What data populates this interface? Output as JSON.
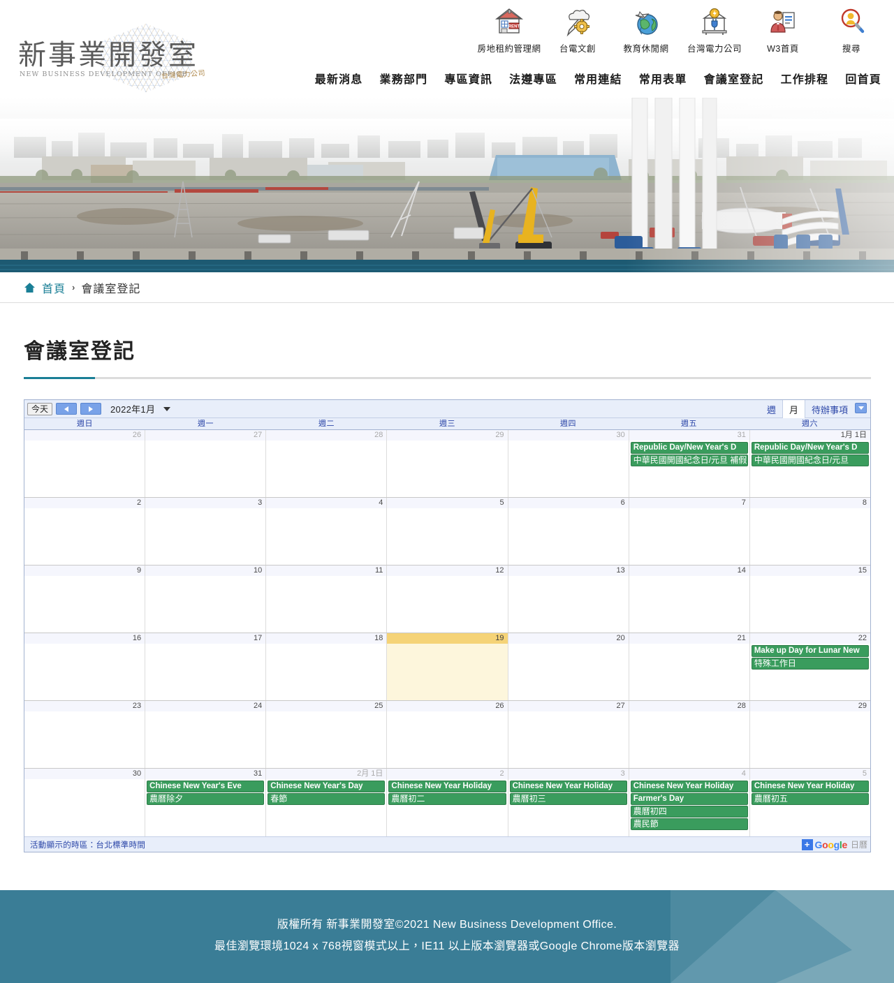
{
  "site": {
    "logo_cn": "新事業開發室",
    "logo_en": "NEW BUSINESS DEVELOPMENT OFFICE",
    "logo_stamp": "台灣電力公司"
  },
  "quicklinks": [
    {
      "label": "房地租約管理網",
      "icon": "house-rent-icon"
    },
    {
      "label": "台電文創",
      "icon": "pen-gear-icon"
    },
    {
      "label": "教育休閒網",
      "icon": "globe-plane-icon"
    },
    {
      "label": "台灣電力公司",
      "icon": "power-plant-icon"
    },
    {
      "label": "W3首頁",
      "icon": "person-document-icon"
    },
    {
      "label": "搜尋",
      "icon": "search-person-icon"
    }
  ],
  "mainnav": [
    {
      "label": "最新消息"
    },
    {
      "label": "業務部門"
    },
    {
      "label": "專區資訊"
    },
    {
      "label": "法遵專區"
    },
    {
      "label": "常用連結"
    },
    {
      "label": "常用表單"
    },
    {
      "label": "會議室登記"
    },
    {
      "label": "工作排程"
    },
    {
      "label": "回首頁"
    }
  ],
  "breadcrumb": {
    "home_label": "首頁",
    "separator": "›",
    "current": "會議室登記"
  },
  "page": {
    "title": "會議室登記",
    "accent_color": "#1a7f96"
  },
  "calendar": {
    "today_button": "今天",
    "prev_label": "◀",
    "next_label": "▶",
    "range_label": "2022年1月",
    "views": [
      {
        "label": "週",
        "active": false
      },
      {
        "label": "月",
        "active": true
      },
      {
        "label": "待辦事項",
        "active": false
      }
    ],
    "dow": [
      "週日",
      "週一",
      "週二",
      "週三",
      "週四",
      "週五",
      "週六"
    ],
    "timezone_note": "活動顯示的時區：台北標準時間",
    "google_badge": {
      "plus": "+",
      "word": "Google",
      "suffix": "日曆"
    },
    "event_color": "#3a9c5d",
    "today_color": "#f5d377",
    "weeks": [
      [
        {
          "num": "26",
          "other": true,
          "today": false,
          "events": []
        },
        {
          "num": "27",
          "other": true,
          "today": false,
          "events": []
        },
        {
          "num": "28",
          "other": true,
          "today": false,
          "events": []
        },
        {
          "num": "29",
          "other": true,
          "today": false,
          "events": []
        },
        {
          "num": "30",
          "other": true,
          "today": false,
          "events": []
        },
        {
          "num": "31",
          "other": true,
          "today": false,
          "events": [
            {
              "title": "Republic Day/New Year's D",
              "cn": false
            },
            {
              "title": "中華民國開國紀念日/元旦 補假",
              "cn": true
            }
          ]
        },
        {
          "num": "1月 1日",
          "other": false,
          "today": false,
          "events": [
            {
              "title": "Republic Day/New Year's D",
              "cn": false
            },
            {
              "title": "中華民國開國紀念日/元旦",
              "cn": true
            }
          ]
        }
      ],
      [
        {
          "num": "2",
          "other": false,
          "today": false,
          "events": []
        },
        {
          "num": "3",
          "other": false,
          "today": false,
          "events": []
        },
        {
          "num": "4",
          "other": false,
          "today": false,
          "events": []
        },
        {
          "num": "5",
          "other": false,
          "today": false,
          "events": []
        },
        {
          "num": "6",
          "other": false,
          "today": false,
          "events": []
        },
        {
          "num": "7",
          "other": false,
          "today": false,
          "events": []
        },
        {
          "num": "8",
          "other": false,
          "today": false,
          "events": []
        }
      ],
      [
        {
          "num": "9",
          "other": false,
          "today": false,
          "events": []
        },
        {
          "num": "10",
          "other": false,
          "today": false,
          "events": []
        },
        {
          "num": "11",
          "other": false,
          "today": false,
          "events": []
        },
        {
          "num": "12",
          "other": false,
          "today": false,
          "events": []
        },
        {
          "num": "13",
          "other": false,
          "today": false,
          "events": []
        },
        {
          "num": "14",
          "other": false,
          "today": false,
          "events": []
        },
        {
          "num": "15",
          "other": false,
          "today": false,
          "events": []
        }
      ],
      [
        {
          "num": "16",
          "other": false,
          "today": false,
          "events": []
        },
        {
          "num": "17",
          "other": false,
          "today": false,
          "events": []
        },
        {
          "num": "18",
          "other": false,
          "today": false,
          "events": []
        },
        {
          "num": "19",
          "other": false,
          "today": true,
          "events": []
        },
        {
          "num": "20",
          "other": false,
          "today": false,
          "events": []
        },
        {
          "num": "21",
          "other": false,
          "today": false,
          "events": []
        },
        {
          "num": "22",
          "other": false,
          "today": false,
          "events": [
            {
              "title": "Make up Day for Lunar New",
              "cn": false
            },
            {
              "title": "特殊工作日",
              "cn": true
            }
          ]
        }
      ],
      [
        {
          "num": "23",
          "other": false,
          "today": false,
          "events": []
        },
        {
          "num": "24",
          "other": false,
          "today": false,
          "events": []
        },
        {
          "num": "25",
          "other": false,
          "today": false,
          "events": []
        },
        {
          "num": "26",
          "other": false,
          "today": false,
          "events": []
        },
        {
          "num": "27",
          "other": false,
          "today": false,
          "events": []
        },
        {
          "num": "28",
          "other": false,
          "today": false,
          "events": []
        },
        {
          "num": "29",
          "other": false,
          "today": false,
          "events": []
        }
      ],
      [
        {
          "num": "30",
          "other": false,
          "today": false,
          "events": []
        },
        {
          "num": "31",
          "other": false,
          "today": false,
          "events": [
            {
              "title": "Chinese New Year's Eve",
              "cn": false
            },
            {
              "title": "農曆除夕",
              "cn": true
            }
          ]
        },
        {
          "num": "2月 1日",
          "other": true,
          "today": false,
          "events": [
            {
              "title": "Chinese New Year's Day",
              "cn": false
            },
            {
              "title": "春節",
              "cn": true
            }
          ]
        },
        {
          "num": "2",
          "other": true,
          "today": false,
          "events": [
            {
              "title": "Chinese New Year Holiday",
              "cn": false
            },
            {
              "title": "農曆初二",
              "cn": true
            }
          ]
        },
        {
          "num": "3",
          "other": true,
          "today": false,
          "events": [
            {
              "title": "Chinese New Year Holiday",
              "cn": false
            },
            {
              "title": "農曆初三",
              "cn": true
            }
          ]
        },
        {
          "num": "4",
          "other": true,
          "today": false,
          "events": [
            {
              "title": "Chinese New Year Holiday",
              "cn": false
            },
            {
              "title": "Farmer's Day",
              "cn": false
            },
            {
              "title": "農曆初四",
              "cn": true
            },
            {
              "title": "農民節",
              "cn": true
            }
          ]
        },
        {
          "num": "5",
          "other": true,
          "today": false,
          "events": [
            {
              "title": "Chinese New Year Holiday",
              "cn": false
            },
            {
              "title": "農曆初五",
              "cn": true
            }
          ]
        }
      ]
    ]
  },
  "footer": {
    "line1": "版權所有 新事業開發室©2021 New Business Development Office.",
    "line2": "最佳瀏覽環境1024 x 768視窗模式以上，IE11 以上版本瀏覽器或Google Chrome版本瀏覽器",
    "bg_color": "#3a7d96"
  }
}
